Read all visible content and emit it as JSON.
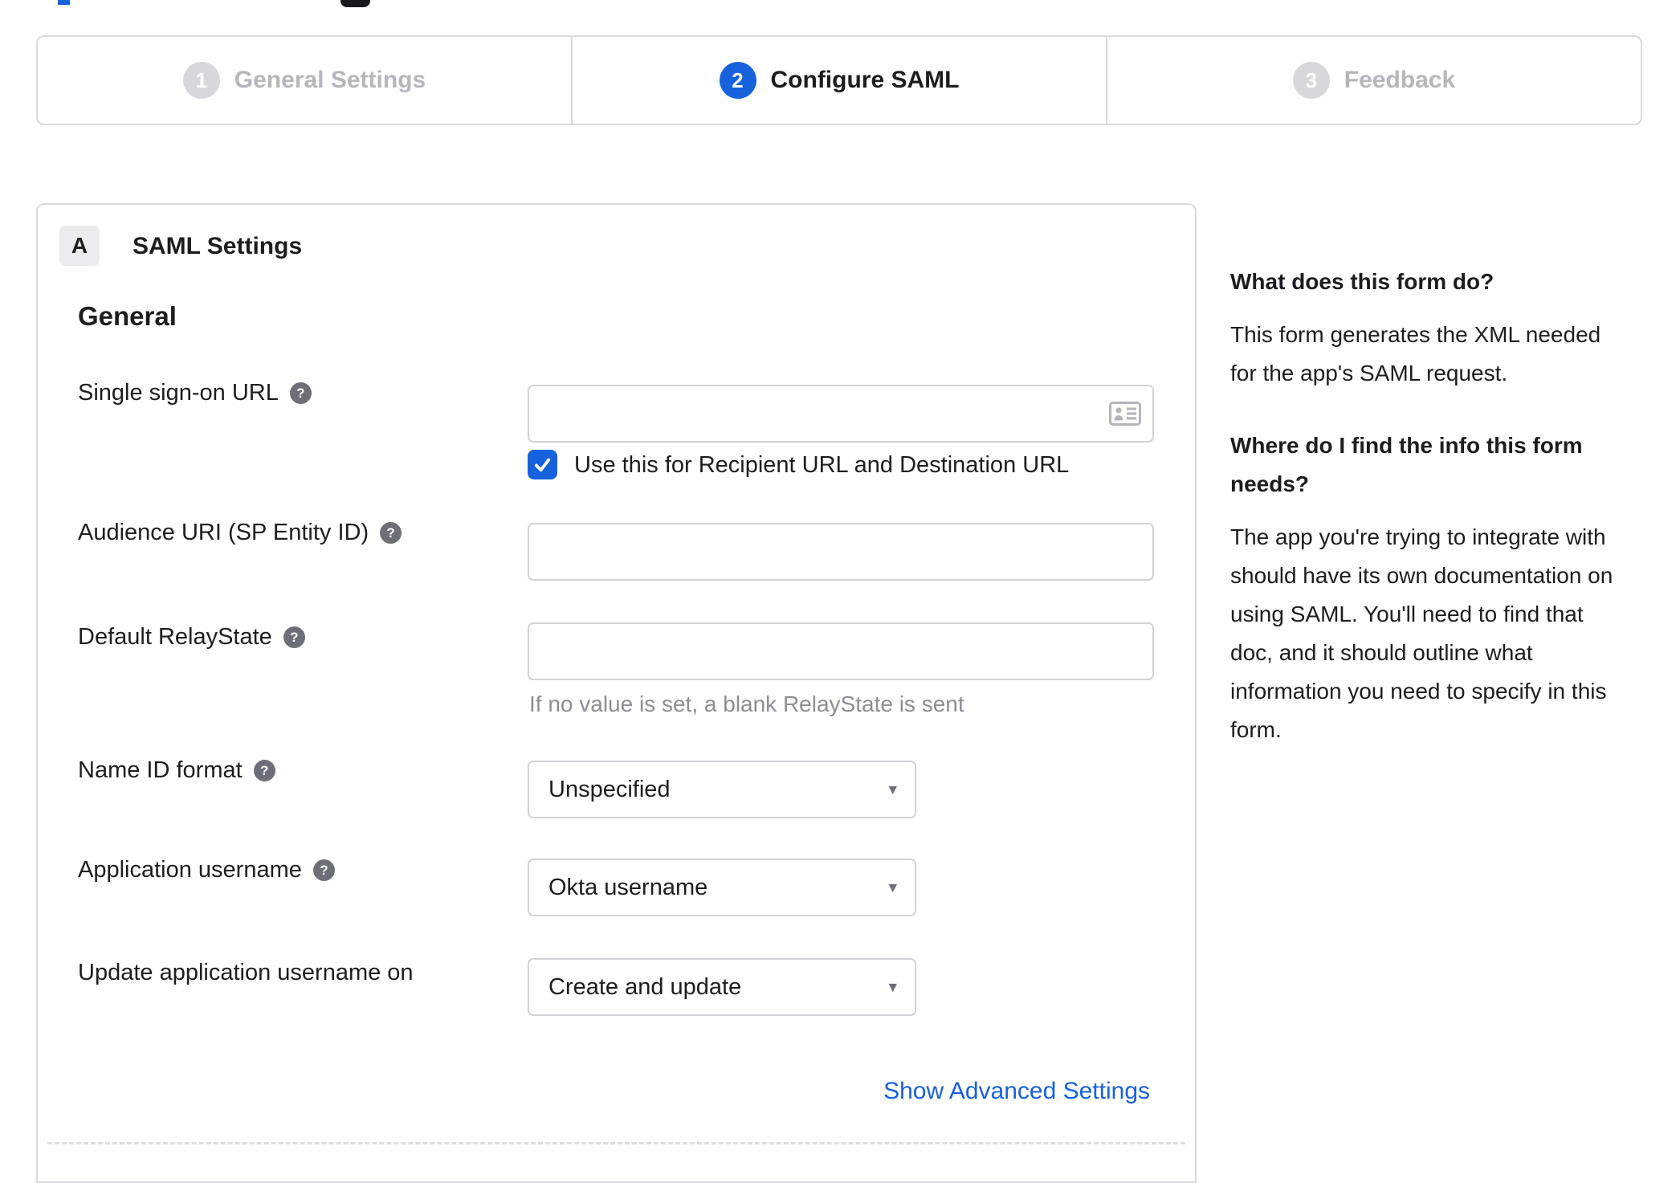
{
  "top_artifacts": {
    "note": "cropped page elements at very top edge"
  },
  "stepper": {
    "steps": [
      {
        "number": "1",
        "label": "General Settings",
        "state": "inactive"
      },
      {
        "number": "2",
        "label": "Configure SAML",
        "state": "active"
      },
      {
        "number": "3",
        "label": "Feedback",
        "state": "inactive"
      }
    ]
  },
  "panel": {
    "section_badge": "A",
    "section_title": "SAML Settings",
    "group_heading": "General",
    "fields": {
      "sso": {
        "label": "Single sign-on URL",
        "value": "",
        "has_help": true,
        "checkbox_label": "Use this for Recipient URL and Destination URL",
        "checkbox_checked": true
      },
      "audience": {
        "label": "Audience URI (SP Entity ID)",
        "value": "",
        "has_help": true
      },
      "relay": {
        "label": "Default RelayState",
        "value": "",
        "has_help": true,
        "hint": "If no value is set, a blank RelayState is sent"
      },
      "nameid": {
        "label": "Name ID format",
        "has_help": true,
        "selected": "Unspecified"
      },
      "appuser": {
        "label": "Application username",
        "has_help": true,
        "selected": "Okta username"
      },
      "updateuser": {
        "label": "Update application username on",
        "has_help": false,
        "selected": "Create and update"
      }
    },
    "advanced_link": "Show Advanced Settings"
  },
  "sidebar": {
    "sections": [
      {
        "heading": "What does this form do?",
        "body": "This form generates the XML needed\nfor the app's SAML request."
      },
      {
        "heading": "Where do I find the info this form\nneeds?",
        "body": "The app you're trying to integrate with\nshould have its own documentation on\nusing SAML. You'll need to find that\ndoc, and it should outline what\ninformation you need to specify in this\nform."
      }
    ]
  },
  "glyphs": {
    "help": "?",
    "caret": "▾"
  },
  "colors": {
    "accent_blue": "#1662dd",
    "inactive_grey": "#d8d8dc",
    "inactive_label": "#b6b6bd",
    "border": "#d2d2d7",
    "text": "#1d1d21",
    "hint": "#8d8d95",
    "help_icon_bg": "#6e6e78",
    "badge_bg": "#ececee",
    "icon_grey": "#b4b4bb"
  }
}
